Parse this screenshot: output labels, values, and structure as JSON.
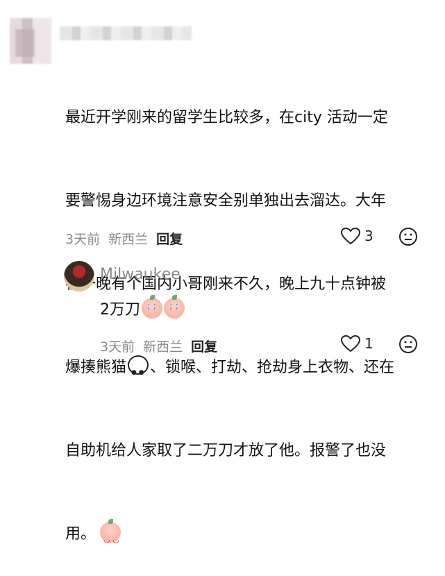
{
  "comment": {
    "text_line1": "最近开学刚来的留学生比较多，在city 活动一定",
    "text_line2": "要警惕身边环境注意安全别单独出去溜达。大年",
    "text_line3": "初一晚有个国内小哥刚来不久，晚上九十点钟被",
    "text_line4a": "爆揍熊猫",
    "text_line4b": "、锁喉、打劫、抢劫身上衣物、还在",
    "text_line5": "自助机给人家取了二万刀才放了他。报警了也没",
    "text_line6": "用。",
    "time": "3天前",
    "location": "新西兰",
    "reply_label": "回复",
    "like_count": "3"
  },
  "reply": {
    "username": "Milwaukee",
    "text": "2万刀",
    "time": "3天前",
    "location": "新西兰",
    "reply_label": "回复",
    "like_count": "1"
  },
  "icons": {
    "like": "heart-outline-icon",
    "dislike": "unhappy-face-icon",
    "emoji_panda": "panda-icon",
    "emoji_face": "peach-face-emoji",
    "emoji_cry": "crying-peach-emoji"
  }
}
